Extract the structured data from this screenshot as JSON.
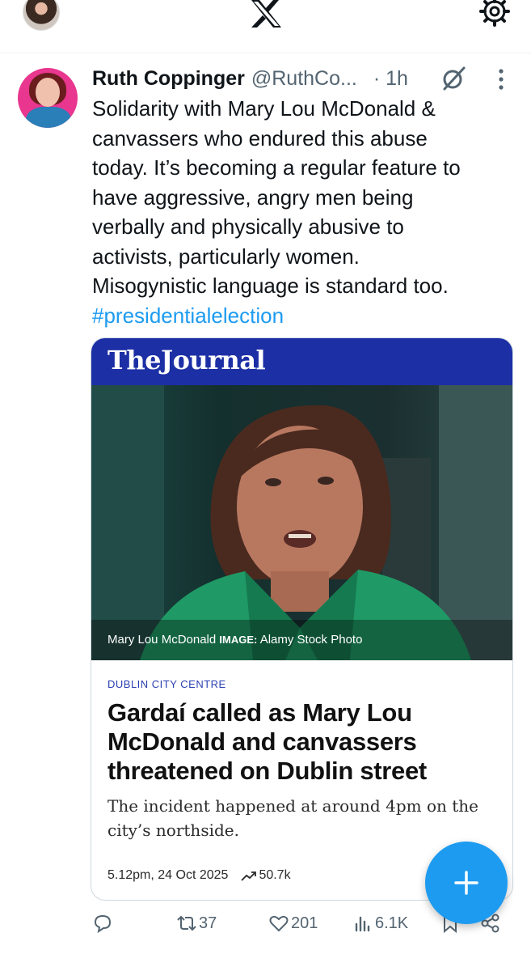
{
  "tweet": {
    "author_name": "Ruth Coppinger",
    "author_handle": "@RuthCo...",
    "time": "· 1h",
    "text_lines": [
      "Solidarity with Mary Lou McDonald &",
      "canvassers who endured this abuse",
      "today. It’s becoming a regular feature to",
      "have aggressive, angry men being",
      "verbally and physically abusive to",
      "activists, particularly women.",
      "Misogynistic language is standard too."
    ],
    "hashtag": "#presidentialelection"
  },
  "card": {
    "brand": "TheJournal",
    "photo_caption_name": "Mary Lou McDonald",
    "photo_caption_label": "IMAGE:",
    "photo_caption_credit": "Alamy Stock Photo",
    "kicker": "DUBLIN CITY CENTRE",
    "headline": "Gardaí called as Mary Lou McDonald and canvassers threatened on Dublin street",
    "dek": "The incident happened at around 4pm on the city’s northside.",
    "timestamp": "5.12pm, 24 Oct 2025",
    "views": "50.7k"
  },
  "actions": {
    "retweets": "37",
    "likes": "201",
    "views": "6.1K"
  },
  "colors": {
    "accent": "#1d9bf0",
    "journal_banner": "#1c2fa5",
    "avatar_bg": "#e9368f"
  },
  "icons": [
    "x-logo-icon",
    "gear-icon",
    "grok-icon",
    "more-icon",
    "reply-icon",
    "retweet-icon",
    "heart-icon",
    "views-icon",
    "bookmark-icon",
    "share-icon",
    "trend-icon",
    "plus-icon"
  ]
}
